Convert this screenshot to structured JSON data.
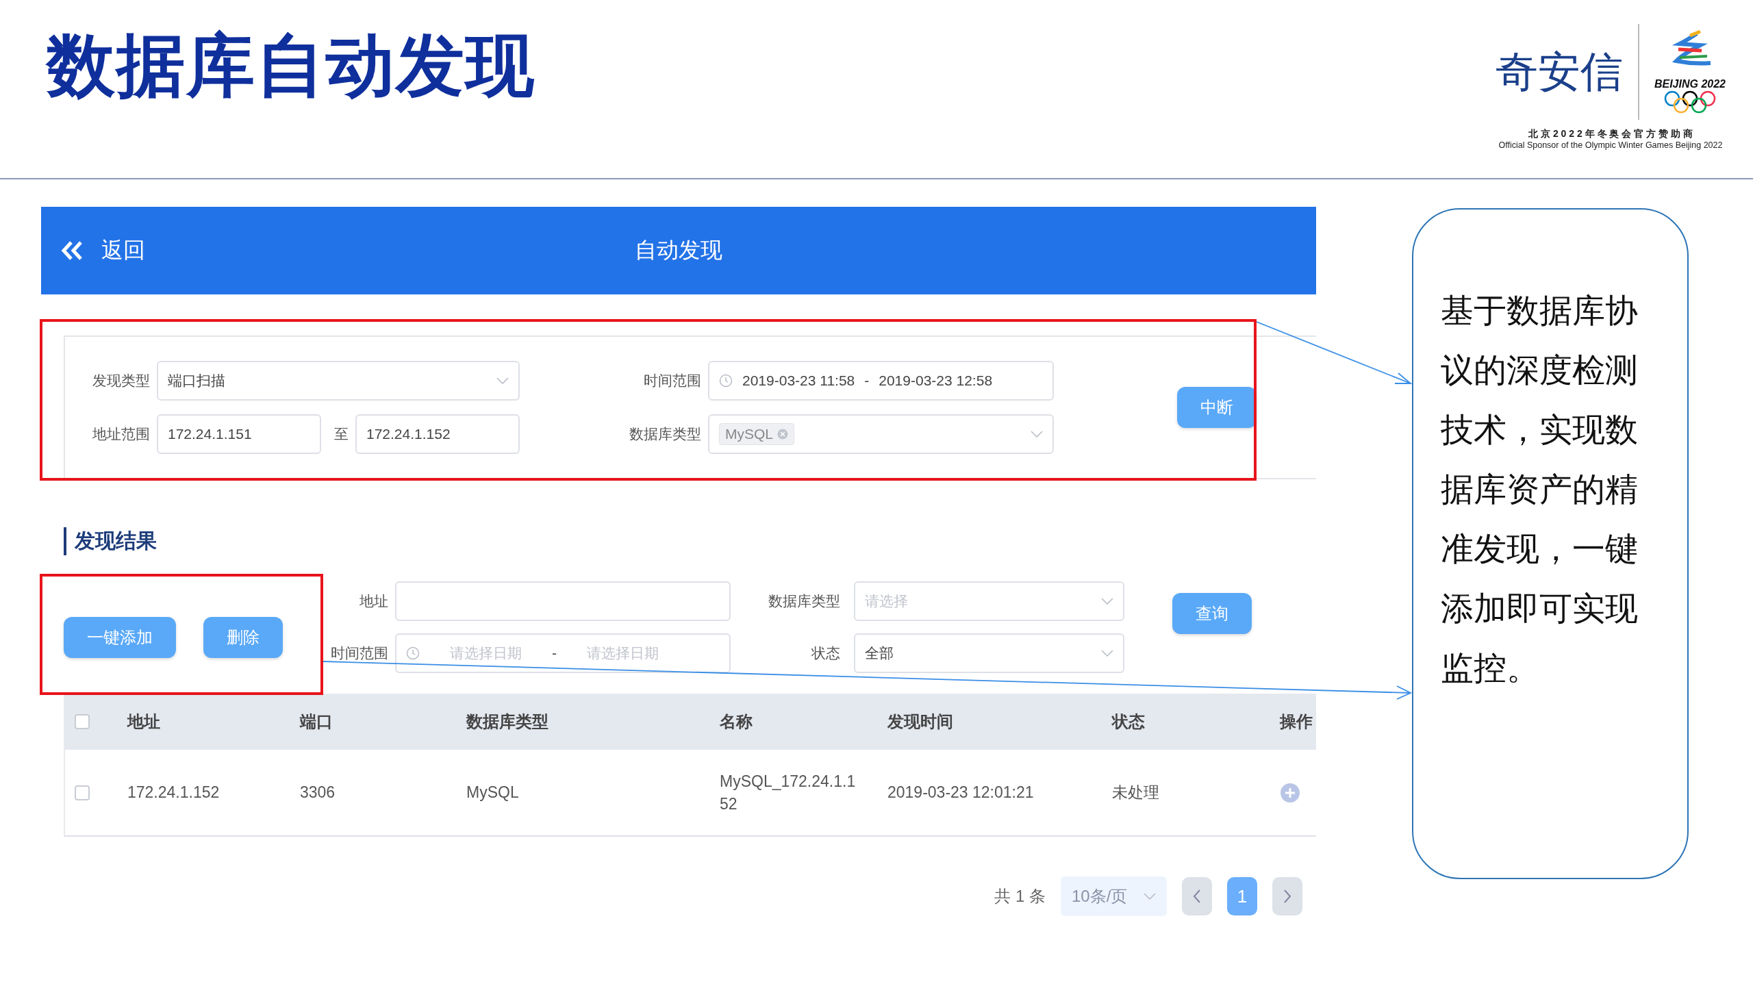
{
  "slide": {
    "title": "数据库自动发现",
    "logo": {
      "brand": "奇安信",
      "emblem_text": "BEIJING 2022",
      "sponsor_cn": "北 京 2 0 2 2 年 冬 奥 会 官 方 赞 助 商",
      "sponsor_en": "Official Sponsor of the Olympic Winter Games Beijing 2022"
    }
  },
  "app": {
    "header": {
      "back": "返回",
      "title": "自动发现"
    },
    "discovery_form": {
      "type_label": "发现类型",
      "type_value": "端口扫描",
      "time_label": "时间范围",
      "time_start": "2019-03-23 11:58",
      "time_sep": "-",
      "time_end": "2019-03-23 12:58",
      "addr_label": "地址范围",
      "addr_start": "172.24.1.151",
      "addr_sep": "至",
      "addr_end": "172.24.1.152",
      "db_label": "数据库类型",
      "db_tags": [
        "MySQL"
      ],
      "stop_button": "中断"
    },
    "results": {
      "heading": "发现结果",
      "actions": [
        "一键添加",
        "删除"
      ],
      "filters": {
        "addr_label": "地址",
        "db_label": "数据库类型",
        "db_placeholder": "请选择",
        "time_label": "时间范围",
        "time_start_placeholder": "请选择日期",
        "time_sep": "-",
        "time_end_placeholder": "请选择日期",
        "status_label": "状态",
        "status_value": "全部",
        "query_button": "查询"
      },
      "table": {
        "header_checked": false,
        "columns": [
          "地址",
          "端口",
          "数据库类型",
          "名称",
          "发现时间",
          "状态",
          "操作"
        ],
        "rows": [
          {
            "checked": false,
            "cells": [
              "172.24.1.152",
              "3306",
              "MySQL",
              "MySQL_172.24.1.152",
              "2019-03-23 12:01:21",
              "未处理"
            ]
          }
        ]
      },
      "pagination": {
        "total": "共 1 条",
        "page_size": "10条/页",
        "pages": [
          {
            "label": "1",
            "selected": true
          }
        ]
      }
    }
  },
  "callout": {
    "text": "基于数据库协议的深度检测技术，实现数据库资产的精准发现，一键添加即可实现监控。"
  }
}
